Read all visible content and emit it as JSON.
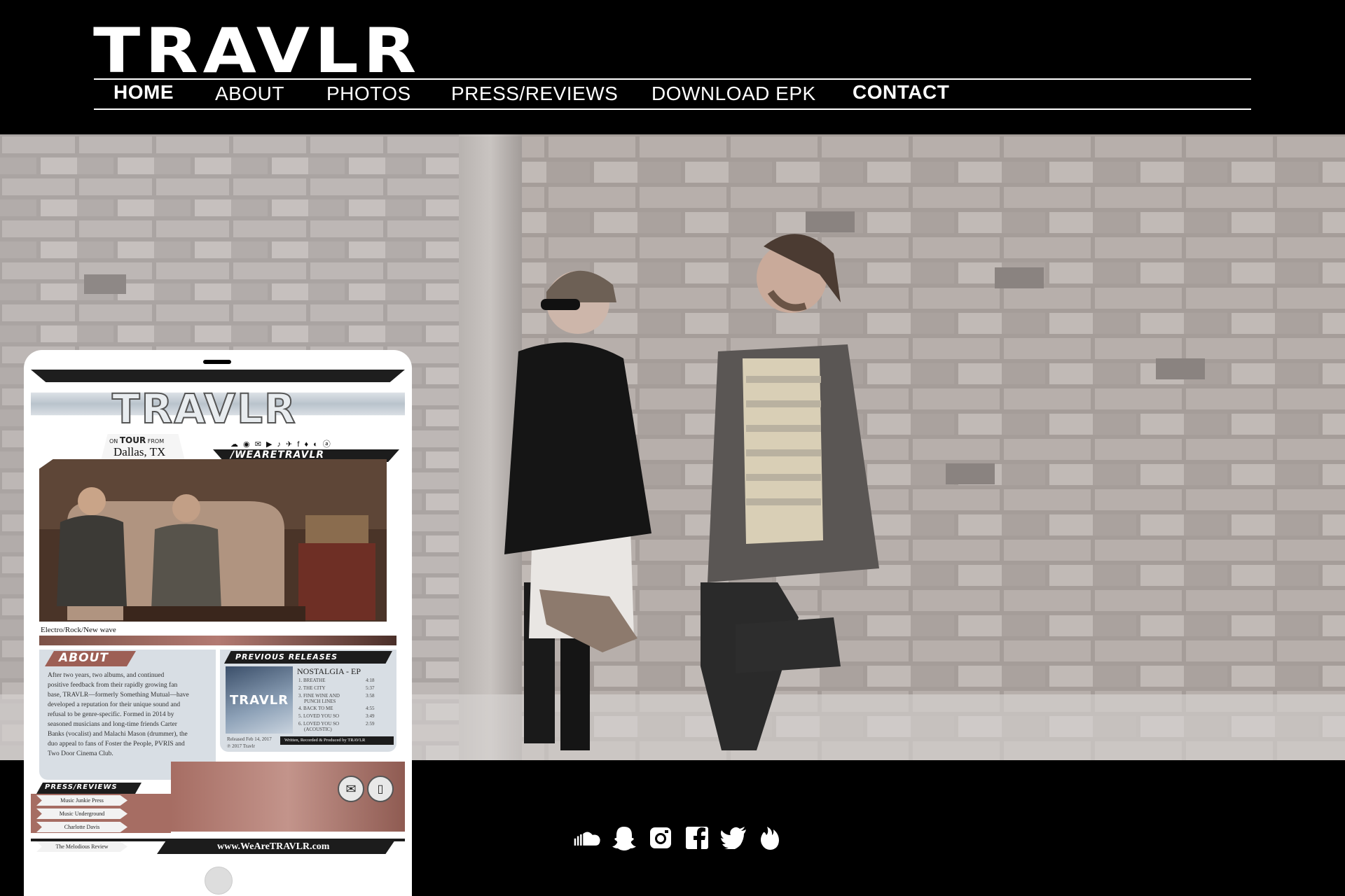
{
  "site": {
    "logo": "TRAVLR"
  },
  "nav": {
    "items": [
      {
        "label": "HOME",
        "bold": true
      },
      {
        "label": "ABOUT",
        "bold": false
      },
      {
        "label": "PHOTOS",
        "bold": false
      },
      {
        "label": "PRESS/REVIEWS",
        "bold": false
      },
      {
        "label": "DOWNLOAD EPK",
        "bold": false
      },
      {
        "label": "CONTACT",
        "bold": true
      }
    ]
  },
  "social": {
    "icons": [
      "soundcloud-icon",
      "snapchat-icon",
      "instagram-icon",
      "facebook-icon",
      "twitter-icon",
      "tinder-flame-icon"
    ]
  },
  "colors": {
    "background": "#000000",
    "text": "#ffffff",
    "epk_accent": "#b37a72",
    "epk_panel": "#d8dee4"
  },
  "epk": {
    "logo": "TRAVLR",
    "tour_line_on": "ON",
    "tour_line_tour": "TOUR",
    "tour_line_from": "FROM",
    "location": "Dallas, TX",
    "handle": "/WEARETRAVLR",
    "genre": "Electro/Rock/New wave",
    "about_heading": "ABOUT",
    "about_lines": [
      "After two years, two albums, and continued",
      "positive feedback from their rapidly growing fan",
      "base, TRAVLR—formerly Something Mutual—have",
      "developed a reputation for their unique sound and",
      "refusal to be genre-specific. Formed in 2014 by",
      "seasoned musicians and long-time friends Carter",
      "Banks (vocalist) and Malachi Mason (drummer), the",
      "duo appeal to fans of Foster the People, PVRIS and",
      "Two Door Cinema Club."
    ],
    "releases_heading": "PREVIOUS RELEASES",
    "album_title": "NOSTALGIA - EP",
    "album_cover_text": "TRAVLR",
    "tracks": [
      {
        "name": "1. BREATHE",
        "time": "4:18"
      },
      {
        "name": "2. THE CITY",
        "time": "5:37"
      },
      {
        "name": "3. FINE WINE AND",
        "time": "3:58"
      },
      {
        "name": "PUNCH LINES",
        "time": ""
      },
      {
        "name": "4. BACK TO ME",
        "time": "4:55"
      },
      {
        "name": "5. LOVED YOU SO",
        "time": "3:49"
      },
      {
        "name": "6. LOVED YOU SO",
        "time": "2:59"
      },
      {
        "name": "(ACOUSTIC)",
        "time": ""
      }
    ],
    "release_date": "Released Feb 14, 2017",
    "copyright": "℗ 2017 Travlr",
    "credits": "Written, Recorded & Produced by TRAVLR",
    "press_heading": "PRESS/REVIEWS",
    "press": [
      "Music Junkie Press",
      "Music Underground",
      "Charlotte Davis",
      "The Melodious Review"
    ],
    "website": "www.WeAreTRAVLR.com"
  }
}
